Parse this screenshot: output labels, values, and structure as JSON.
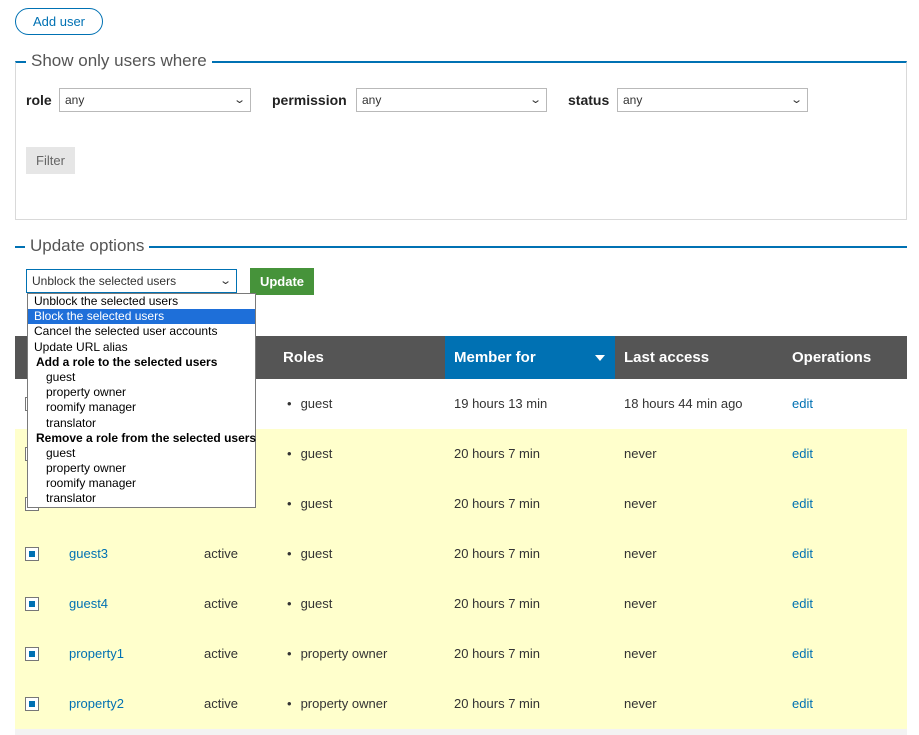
{
  "add_user": "Add user",
  "filter_box": {
    "legend": "Show only users where",
    "role_label": "role",
    "role_value": "any",
    "permission_label": "permission",
    "permission_value": "any",
    "status_label": "status",
    "status_value": "any",
    "filter_button": "Filter"
  },
  "update_box": {
    "legend": "Update options",
    "selected": "Unblock the selected users",
    "update_button": "Update",
    "options": [
      {
        "label": "Unblock the selected users",
        "kind": "opt"
      },
      {
        "label": "Block the selected users",
        "kind": "opt",
        "highlighted": true
      },
      {
        "label": "Cancel the selected user accounts",
        "kind": "opt"
      },
      {
        "label": "Update URL alias",
        "kind": "opt"
      },
      {
        "label": "Add a role to the selected users",
        "kind": "group"
      },
      {
        "label": "guest",
        "kind": "sub"
      },
      {
        "label": "property owner",
        "kind": "sub"
      },
      {
        "label": "roomify manager",
        "kind": "sub"
      },
      {
        "label": "translator",
        "kind": "sub"
      },
      {
        "label": "Remove a role from the selected users",
        "kind": "group"
      },
      {
        "label": "guest",
        "kind": "sub"
      },
      {
        "label": "property owner",
        "kind": "sub"
      },
      {
        "label": "roomify manager",
        "kind": "sub"
      },
      {
        "label": "translator",
        "kind": "sub"
      }
    ]
  },
  "table": {
    "headers": {
      "roles": "Roles",
      "member_for": "Member for",
      "last_access": "Last access",
      "operations": "Operations"
    },
    "rows": [
      {
        "username": "",
        "status": "",
        "role": "guest",
        "member_for": "19 hours 13 min",
        "last_access": "18 hours 44 min ago",
        "op": "edit",
        "checked": false
      },
      {
        "username": "",
        "status": "",
        "role": "guest",
        "member_for": "20 hours 7 min",
        "last_access": "never",
        "op": "edit",
        "checked": true
      },
      {
        "username": "",
        "status": "",
        "role": "guest",
        "member_for": "20 hours 7 min",
        "last_access": "never",
        "op": "edit",
        "checked": true
      },
      {
        "username": "guest3",
        "status": "active",
        "role": "guest",
        "member_for": "20 hours 7 min",
        "last_access": "never",
        "op": "edit",
        "checked": true
      },
      {
        "username": "guest4",
        "status": "active",
        "role": "guest",
        "member_for": "20 hours 7 min",
        "last_access": "never",
        "op": "edit",
        "checked": true
      },
      {
        "username": "property1",
        "status": "active",
        "role": "property owner",
        "member_for": "20 hours 7 min",
        "last_access": "never",
        "op": "edit",
        "checked": true
      },
      {
        "username": "property2",
        "status": "active",
        "role": "property owner",
        "member_for": "20 hours 7 min",
        "last_access": "never",
        "op": "edit",
        "checked": true
      }
    ]
  },
  "colors": {
    "accent": "#0071b3",
    "update_green": "#46933a",
    "header_gray": "#555555",
    "selected_row": "#ffffcc"
  }
}
